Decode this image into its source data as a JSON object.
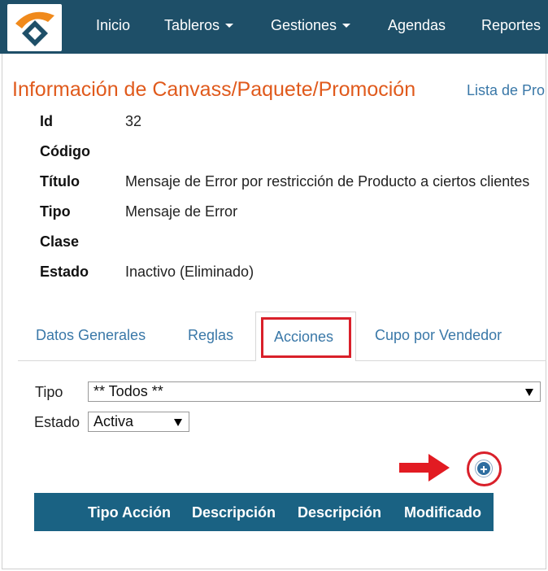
{
  "navbar": {
    "items": [
      {
        "label": "Inicio"
      },
      {
        "label": "Tableros"
      },
      {
        "label": "Gestiones"
      },
      {
        "label": "Agendas"
      },
      {
        "label": "Reportes"
      }
    ]
  },
  "header": {
    "title": "Información de Canvass/Paquete/Promoción",
    "list_link": "Lista de Pro"
  },
  "details": {
    "id_label": "Id",
    "id_value": "32",
    "codigo_label": "Código",
    "codigo_value": "",
    "titulo_label": "Título",
    "titulo_value": "Mensaje de Error por restricción de Producto a ciertos clientes",
    "tipo_label": "Tipo",
    "tipo_value": "Mensaje de Error",
    "clase_label": "Clase",
    "clase_value": "",
    "estado_label": "Estado",
    "estado_value": "Inactivo (Eliminado)"
  },
  "tabs": [
    {
      "label": "Datos Generales"
    },
    {
      "label": "Reglas"
    },
    {
      "label": "Acciones",
      "active": true
    },
    {
      "label": "Cupo por Vendedor"
    }
  ],
  "filters": {
    "tipo_label": "Tipo",
    "tipo_selected": "** Todos **",
    "estado_label": "Estado",
    "estado_selected": "Activa"
  },
  "add_button": {
    "icon": "plus-circle-icon"
  },
  "table": {
    "columns": [
      "Tipo Acción",
      "Descripción",
      "Descripción",
      "Modificado"
    ]
  },
  "colors": {
    "navbar": "#1e4f68",
    "title": "#e05a1c",
    "link": "#3a78a8",
    "table_header": "#1a6283",
    "highlight": "#d9202a"
  }
}
